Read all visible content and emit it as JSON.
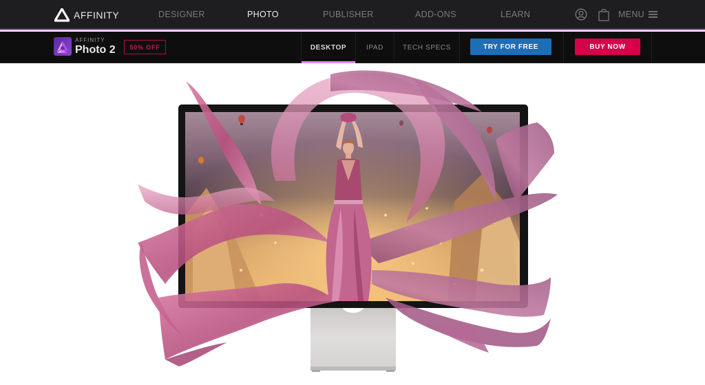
{
  "topnav": {
    "brand": "AFFINITY",
    "links": [
      {
        "label": "DESIGNER",
        "active": false
      },
      {
        "label": "PHOTO",
        "active": true
      },
      {
        "label": "PUBLISHER",
        "active": false
      },
      {
        "label": "ADD-ONS",
        "active": false
      },
      {
        "label": "LEARN",
        "active": false
      }
    ],
    "icons": {
      "account": "user-circle-icon",
      "cart": "shopping-bag-icon",
      "menu": "hamburger-icon"
    },
    "menu_label": "MENU"
  },
  "subnav": {
    "product_small": "AFFINITY",
    "product_name": "Photo 2",
    "sale_badge": "50% OFF",
    "tabs": [
      {
        "label": "DESKTOP",
        "active": true
      },
      {
        "label": "IPAD",
        "active": false
      },
      {
        "label": "TECH SPECS",
        "active": false
      }
    ],
    "try_button": "TRY FOR FREE",
    "buy_button": "BUY NOW"
  },
  "hero": {
    "image_description": "Woman in flowing pink silk fabric bursting out of a desktop monitor displaying a twilight cityscape with hot-air balloons",
    "device": "monitor-on-stand"
  },
  "colors": {
    "topnav_bg": "#1e1e20",
    "topnav_accent_line": "#9a5fe0",
    "subnav_bg": "#0e0e0f",
    "active_tab_indicator": "#e389ee",
    "sale_badge": "#d01a4e",
    "try_button": "#1d6eb8",
    "buy_button": "#d6004b",
    "photo_purple": "#7b3fc2"
  }
}
